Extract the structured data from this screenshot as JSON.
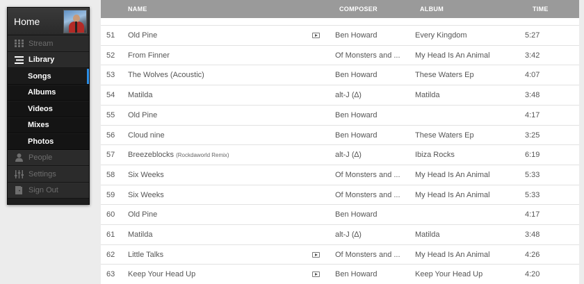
{
  "sidebar": {
    "home_label": "Home",
    "items": [
      {
        "label": "Stream",
        "icon": "stream-icon",
        "state": "dim"
      },
      {
        "label": "Library",
        "icon": "library-icon",
        "state": "active"
      },
      {
        "label": "Songs",
        "state": "sub-selected"
      },
      {
        "label": "Albums",
        "state": "sub"
      },
      {
        "label": "Videos",
        "state": "sub"
      },
      {
        "label": "Mixes",
        "state": "sub"
      },
      {
        "label": "Photos",
        "state": "sub"
      },
      {
        "label": "People",
        "icon": "person-icon",
        "state": "dim"
      },
      {
        "label": "Settings",
        "icon": "sliders-icon",
        "state": "dim"
      },
      {
        "label": "Sign Out",
        "icon": "door-icon",
        "state": "dim"
      }
    ]
  },
  "table": {
    "columns": {
      "name": "NAME",
      "composer": "COMPOSER",
      "album": "ALBUM",
      "time": "TIME"
    },
    "rows": [
      {
        "num": "51",
        "name": "Old Pine",
        "video": true,
        "composer": "Ben Howard",
        "album": "Every Kingdom",
        "time": "5:27"
      },
      {
        "num": "52",
        "name": "From Finner",
        "video": false,
        "composer": "Of Monsters and ...",
        "album": "My Head Is An Animal",
        "time": "3:42"
      },
      {
        "num": "53",
        "name": "The Wolves (Acoustic)",
        "video": false,
        "composer": "Ben Howard",
        "album": "These Waters Ep",
        "time": "4:07"
      },
      {
        "num": "54",
        "name": "Matilda",
        "video": false,
        "composer": "alt-J (∆)",
        "album": "Matilda",
        "time": "3:48"
      },
      {
        "num": "55",
        "name": "Old Pine",
        "video": false,
        "composer": "Ben Howard",
        "album": "",
        "time": "4:17"
      },
      {
        "num": "56",
        "name": "Cloud nine",
        "video": false,
        "composer": "Ben Howard",
        "album": "These Waters Ep",
        "time": "3:25"
      },
      {
        "num": "57",
        "name": "Breezeblocks",
        "name_note": "(Rockdaworld Remix)",
        "video": false,
        "composer": "alt-J (∆)",
        "album": "Ibiza Rocks",
        "time": "6:19"
      },
      {
        "num": "58",
        "name": "Six Weeks",
        "video": false,
        "composer": "Of Monsters and ...",
        "album": "My Head Is An Animal",
        "time": "5:33"
      },
      {
        "num": "59",
        "name": "Six Weeks",
        "video": false,
        "composer": "Of Monsters and ...",
        "album": "My Head Is An Animal",
        "time": "5:33"
      },
      {
        "num": "60",
        "name": "Old Pine",
        "video": false,
        "composer": "Ben Howard",
        "album": "",
        "time": "4:17"
      },
      {
        "num": "61",
        "name": "Matilda",
        "video": false,
        "composer": "alt-J (∆)",
        "album": "Matilda",
        "time": "3:48"
      },
      {
        "num": "62",
        "name": "Little Talks",
        "video": true,
        "composer": "Of Monsters and ...",
        "album": "My Head Is An Animal",
        "time": "4:26"
      },
      {
        "num": "63",
        "name": "Keep Your Head Up",
        "video": true,
        "composer": "Ben Howard",
        "album": "Keep Your Head Up",
        "time": "4:20"
      }
    ]
  },
  "colors": {
    "accent": "#2c8ee6",
    "header_bg": "#9a9a9a",
    "sidebar_bg": "#1e1e1e"
  }
}
